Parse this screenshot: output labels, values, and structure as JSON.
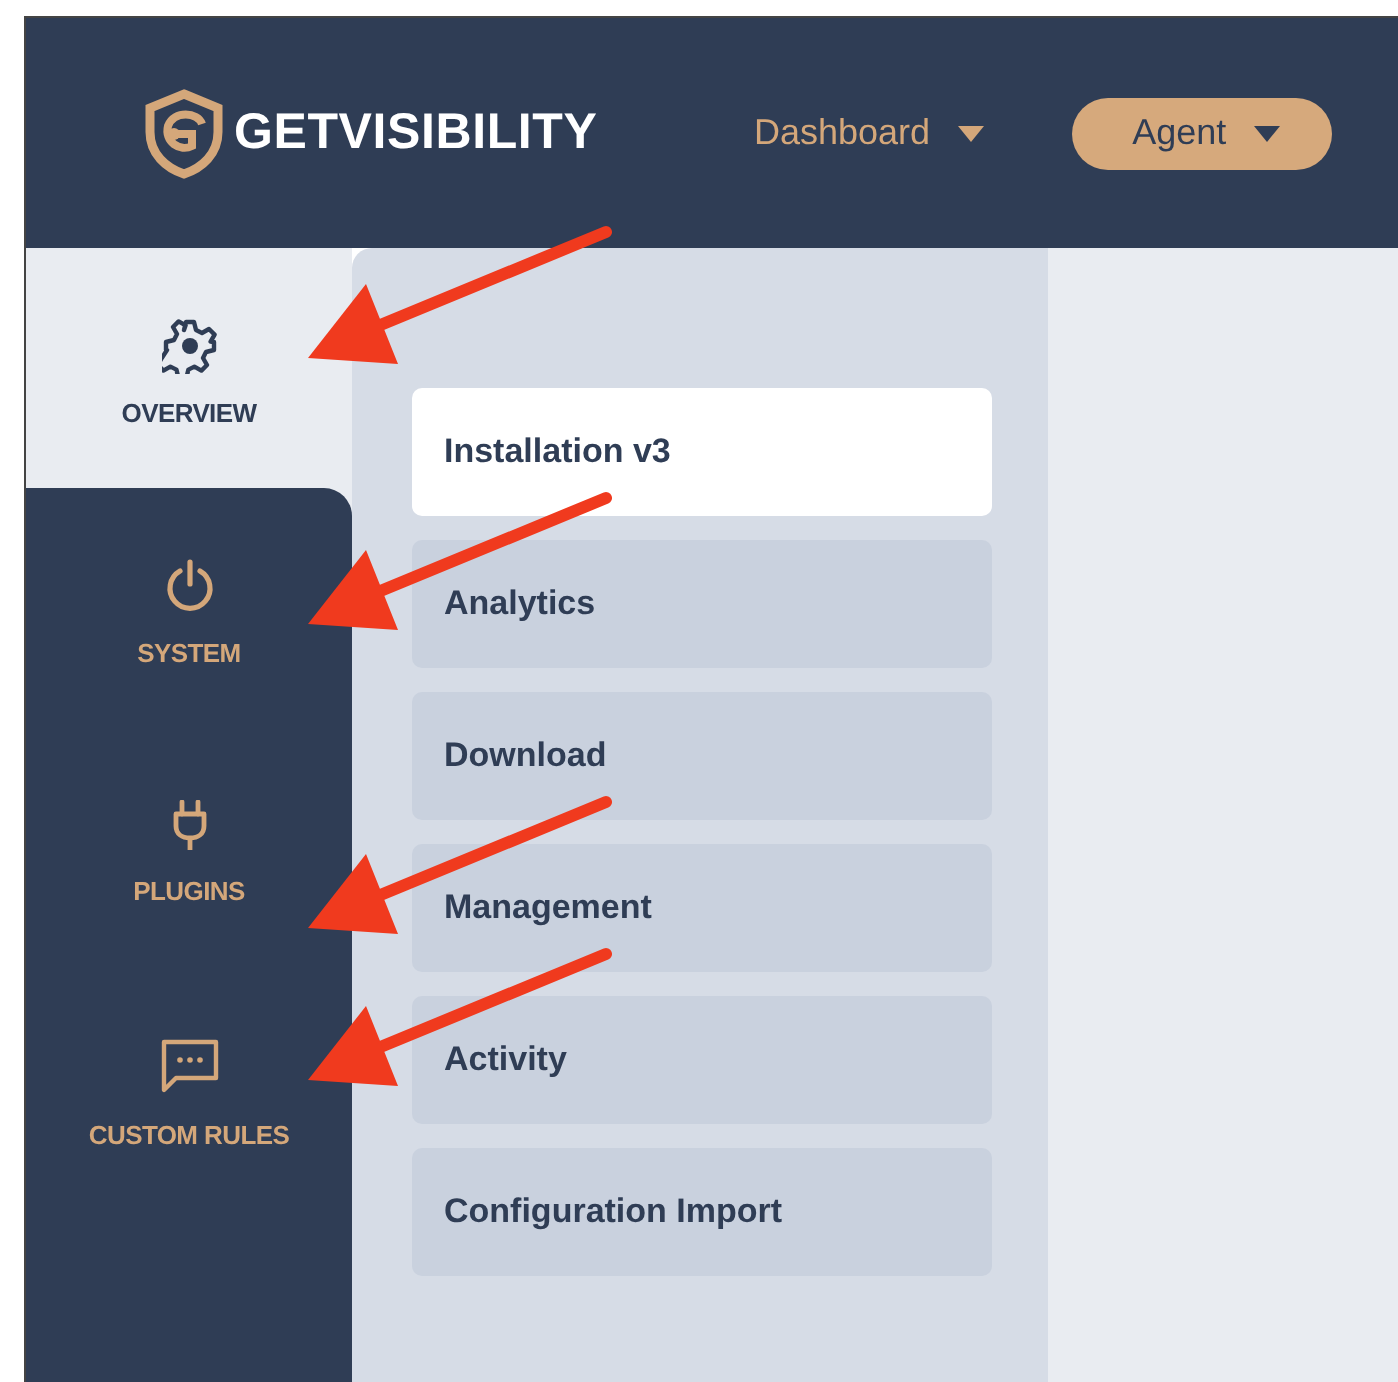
{
  "header": {
    "logo": "GETVISIBILITY",
    "menus": [
      {
        "label": "Dashboard",
        "kind": "plain"
      },
      {
        "label": "Agent",
        "kind": "pill"
      }
    ]
  },
  "sidebar": {
    "items": [
      {
        "label": "OVERVIEW",
        "kind": "gear",
        "selected": true,
        "pointed": true
      },
      {
        "label": "SYSTEM",
        "kind": "power",
        "selected": false,
        "pointed": true
      },
      {
        "label": "PLUGINS",
        "kind": "plug",
        "selected": false,
        "pointed": true
      },
      {
        "label": "CUSTOM RULES",
        "kind": "chat",
        "selected": false,
        "pointed": true
      }
    ]
  },
  "submenu": {
    "items": [
      {
        "label": "Installation v3",
        "selected": true
      },
      {
        "label": "Analytics",
        "selected": false
      },
      {
        "label": "Download",
        "selected": false
      },
      {
        "label": "Management",
        "selected": false
      },
      {
        "label": "Activity",
        "selected": false
      },
      {
        "label": "Configuration Import",
        "selected": false
      }
    ]
  }
}
